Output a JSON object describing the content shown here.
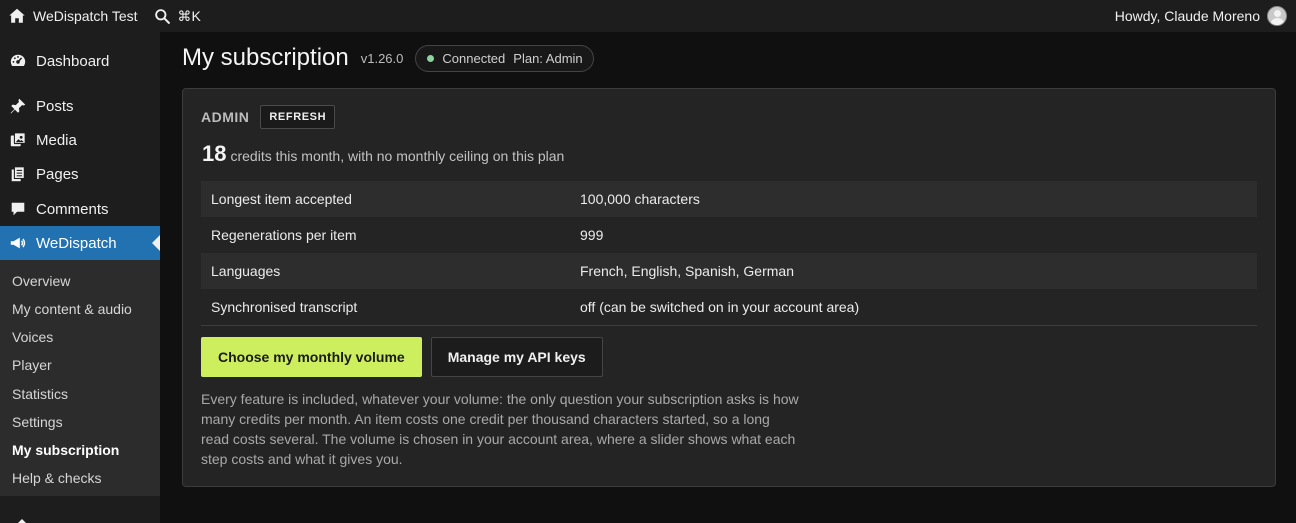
{
  "adminbar": {
    "site_name": "WeDispatch Test",
    "search_shortcut": "⌘K",
    "howdy": "Howdy, Claude Moreno"
  },
  "sidebar": {
    "items": [
      {
        "label": "Dashboard",
        "icon": "dashboard-icon"
      },
      {
        "label": "Posts",
        "icon": "pin-icon"
      },
      {
        "label": "Media",
        "icon": "media-icon"
      },
      {
        "label": "Pages",
        "icon": "pages-icon"
      },
      {
        "label": "Comments",
        "icon": "comment-icon"
      },
      {
        "label": "WeDispatch",
        "icon": "megaphone-icon",
        "active": true
      }
    ],
    "submenu": [
      {
        "label": "Overview"
      },
      {
        "label": "My content & audio"
      },
      {
        "label": "Voices"
      },
      {
        "label": "Player"
      },
      {
        "label": "Statistics"
      },
      {
        "label": "Settings"
      },
      {
        "label": "My subscription",
        "current": true
      },
      {
        "label": "Help & checks"
      }
    ]
  },
  "header": {
    "title": "My subscription",
    "version": "v1.26.0",
    "status": "Connected",
    "plan": "Plan: Admin"
  },
  "card": {
    "plan_name": "ADMIN",
    "refresh_label": "REFRESH",
    "credits": "18",
    "credits_text": "credits this month, with no monthly ceiling on this plan",
    "features": [
      {
        "label": "Longest item accepted",
        "value": "100,000 characters"
      },
      {
        "label": "Regenerations per item",
        "value": "999"
      },
      {
        "label": "Languages",
        "value": "French, English, Spanish, German"
      },
      {
        "label": "Synchronised transcript",
        "value": "off (can be switched on in your account area)"
      }
    ],
    "primary_button": "Choose my monthly volume",
    "secondary_button": "Manage my API keys",
    "explanation": "Every feature is included, whatever your volume: the only question your subscription asks is how many credits per month. An item costs one credit per thousand characters started, so a long read costs several. The volume is chosen in your account area, where a slider shows what each step costs and what it gives you."
  },
  "colors": {
    "accent_primary": "#cdef5e",
    "menu_active": "#2271b1",
    "status_connected": "#8fd3a0"
  }
}
